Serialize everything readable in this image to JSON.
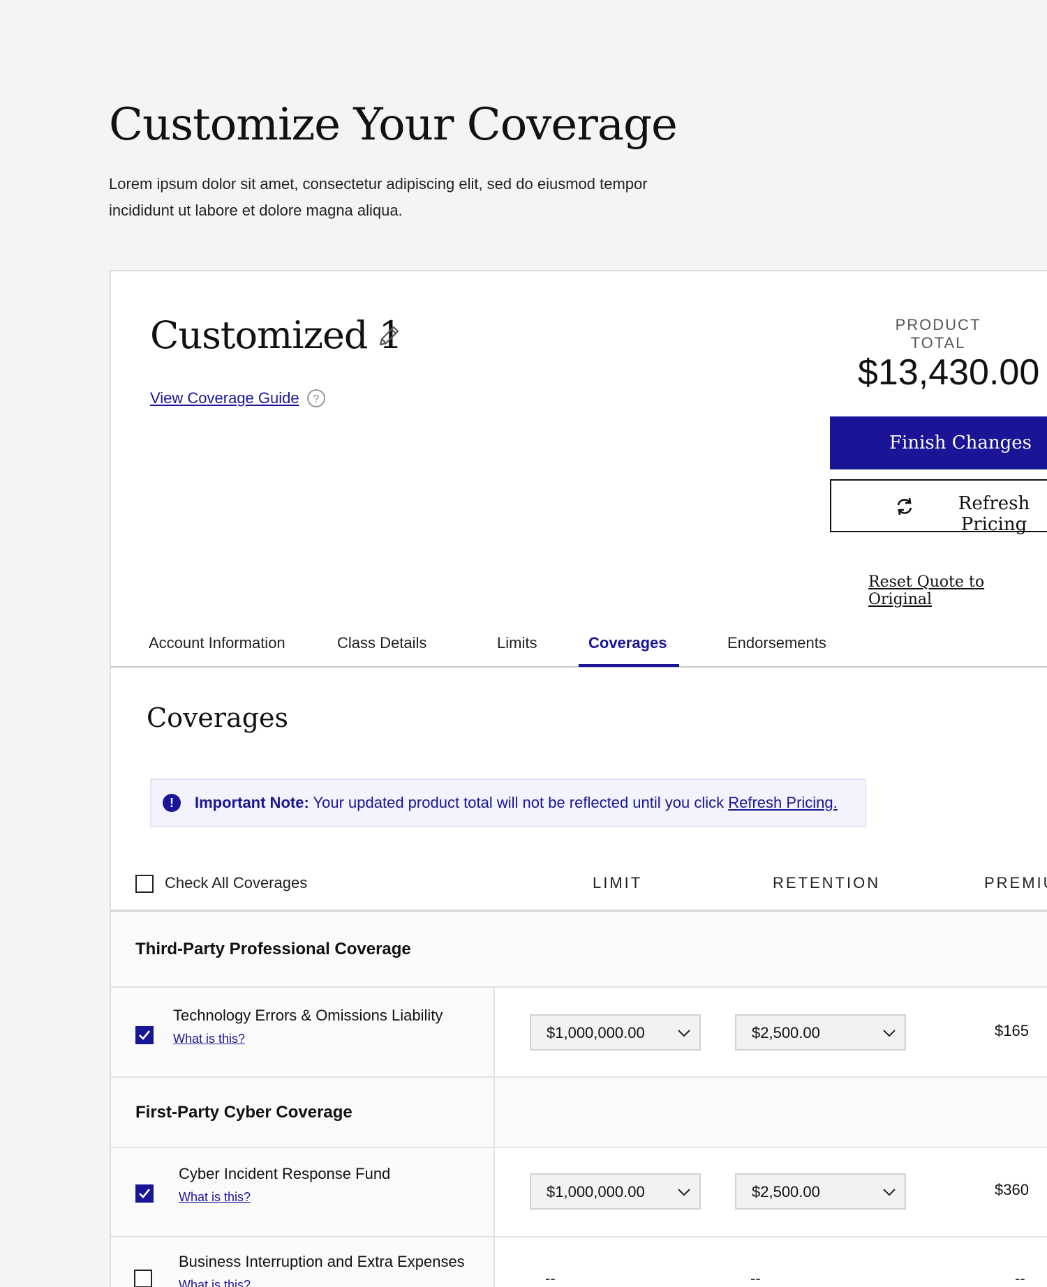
{
  "page": {
    "title": "Customize Your Coverage",
    "description": "Lorem ipsum dolor sit amet, consectetur adipiscing elit, sed do eiusmod tempor incididunt ut labore et dolore magna aliqua."
  },
  "quote": {
    "name": "Customized 1",
    "guide_link": "View Coverage Guide",
    "help_glyph": "?",
    "total_label": "PRODUCT TOTAL",
    "total_value": "$13,430.00",
    "finish_label": "Finish Changes",
    "refresh_label": "Refresh Pricing",
    "reset_label": "Reset Quote to Original"
  },
  "tabs": [
    {
      "label": "Account Information",
      "active": false
    },
    {
      "label": "Class Details",
      "active": false
    },
    {
      "label": "Limits",
      "active": false
    },
    {
      "label": "Coverages",
      "active": true
    },
    {
      "label": "Endorsements",
      "active": false
    }
  ],
  "section": {
    "title": "Coverages",
    "note_icon": "!",
    "note_bold": "Important Note:",
    "note_text": " Your updated product total will not be reflected until you click ",
    "note_link": "Refresh Pricing."
  },
  "table": {
    "check_all": "Check All Coverages",
    "col_limit": "LIMIT",
    "col_retention": "RETENTION",
    "col_premium": "PREMIU",
    "groups": [
      {
        "title": "Third-Party Professional Coverage",
        "rows": [
          {
            "name": "Technology Errors & Omissions Liability",
            "what": "What is this?",
            "checked": true,
            "limit": "$1,000,000.00",
            "retention": "$2,500.00",
            "premium": "$165"
          }
        ]
      },
      {
        "title": "First-Party Cyber Coverage",
        "rows": [
          {
            "name": "Cyber Incident Response Fund",
            "what": "What is this?",
            "checked": true,
            "limit": "$1,000,000.00",
            "retention": "$2,500.00",
            "premium": "$360"
          },
          {
            "name": "Business Interruption and Extra Expenses",
            "what": "What is this?",
            "checked": false,
            "limit": "--",
            "retention": "--",
            "premium": "--"
          }
        ]
      }
    ]
  },
  "colors": {
    "accent": "#1a1597",
    "background": "#f4f4f4",
    "note_bg": "#f2f3fc"
  },
  "icons": [
    "pencil-icon",
    "help-circle-icon",
    "refresh-icon",
    "info-icon",
    "check-icon",
    "chevron-down-icon"
  ]
}
